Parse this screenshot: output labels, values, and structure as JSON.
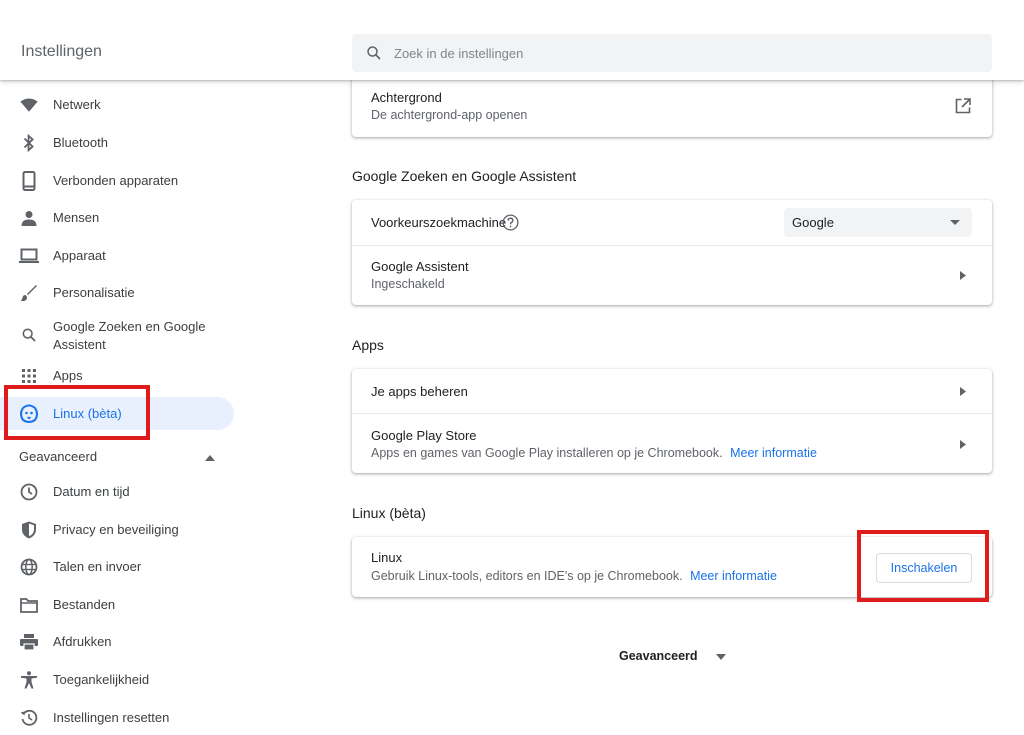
{
  "header": {
    "app_title": "Instellingen",
    "search_placeholder": "Zoek in de instellingen"
  },
  "sidebar": {
    "items": [
      {
        "label": "Netwerk",
        "icon": "wifi-icon"
      },
      {
        "label": "Bluetooth",
        "icon": "bluetooth-icon"
      },
      {
        "label": "Verbonden apparaten",
        "icon": "phone-icon"
      },
      {
        "label": "Mensen",
        "icon": "person-icon"
      },
      {
        "label": "Apparaat",
        "icon": "laptop-icon"
      },
      {
        "label": "Personalisatie",
        "icon": "brush-icon"
      },
      {
        "label": "Google Zoeken en Google",
        "label2": "Assistent",
        "icon": "search-icon"
      },
      {
        "label": "Apps",
        "icon": "apps-grid-icon"
      },
      {
        "label": "Linux (bèta)",
        "icon": "linux-penguin-icon",
        "active": true
      }
    ],
    "advanced_label": "Geavanceerd",
    "advanced_items": [
      {
        "label": "Datum en tijd",
        "icon": "clock-icon"
      },
      {
        "label": "Privacy en beveiliging",
        "icon": "shield-icon"
      },
      {
        "label": "Talen en invoer",
        "icon": "globe-icon"
      },
      {
        "label": "Bestanden",
        "icon": "folder-icon"
      },
      {
        "label": "Afdrukken",
        "icon": "printer-icon"
      },
      {
        "label": "Toegankelijkheid",
        "icon": "accessibility-icon"
      },
      {
        "label": "Instellingen resetten",
        "icon": "history-icon"
      }
    ]
  },
  "main": {
    "wallpaper": {
      "title": "Achtergrond",
      "subtitle": "De achtergrond-app openen"
    },
    "search_section": {
      "title": "Google Zoeken en Google Assistent",
      "engine_label": "Voorkeurszoekmachine",
      "engine_value": "Google",
      "assistant_title": "Google Assistent",
      "assistant_status": "Ingeschakeld"
    },
    "apps_section": {
      "title": "Apps",
      "manage_label": "Je apps beheren",
      "play_title": "Google Play Store",
      "play_desc": "Apps en games van Google Play installeren op je Chromebook.",
      "play_link": "Meer informatie"
    },
    "linux_section": {
      "title": "Linux (bèta)",
      "row_title": "Linux",
      "row_desc": "Gebruik Linux-tools, editors en IDE's op je Chromebook.",
      "row_link": "Meer informatie",
      "enable_button": "Inschakelen"
    },
    "advanced_footer": "Geavanceerd"
  },
  "colors": {
    "accent": "#1a73e8",
    "highlight": "#e01b1b",
    "active_bg": "#e8f0fe"
  }
}
